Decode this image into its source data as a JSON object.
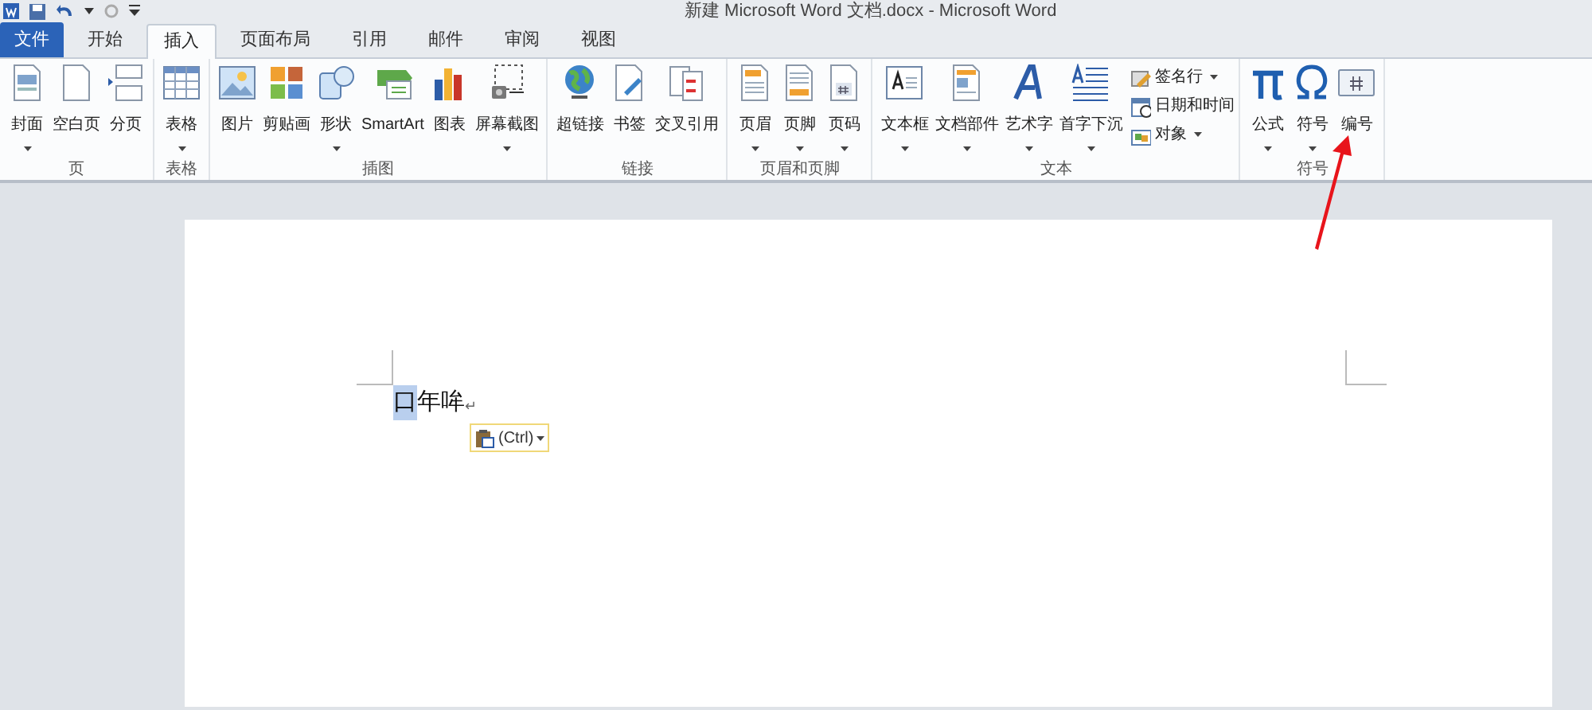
{
  "window": {
    "title": "新建 Microsoft Word 文档.docx - Microsoft Word"
  },
  "tabs": [
    {
      "label": "文件",
      "kind": "file",
      "selected": false
    },
    {
      "label": "开始",
      "kind": "tab",
      "selected": false
    },
    {
      "label": "插入",
      "kind": "tab",
      "selected": true
    },
    {
      "label": "页面布局",
      "kind": "tab",
      "selected": false
    },
    {
      "label": "引用",
      "kind": "tab",
      "selected": false
    },
    {
      "label": "邮件",
      "kind": "tab",
      "selected": false
    },
    {
      "label": "审阅",
      "kind": "tab",
      "selected": false
    },
    {
      "label": "视图",
      "kind": "tab",
      "selected": false
    }
  ],
  "ribbon_groups": [
    {
      "label": "页",
      "buttons": [
        {
          "label": "封面",
          "kind": "large",
          "dropdown": true
        },
        {
          "label": "空白页",
          "kind": "large",
          "dropdown": false
        },
        {
          "label": "分页",
          "kind": "large",
          "dropdown": false
        }
      ]
    },
    {
      "label": "表格",
      "buttons": [
        {
          "label": "表格",
          "kind": "large",
          "dropdown": true
        }
      ]
    },
    {
      "label": "插图",
      "buttons": [
        {
          "label": "图片",
          "kind": "large",
          "dropdown": false
        },
        {
          "label": "剪贴画",
          "kind": "large",
          "dropdown": false
        },
        {
          "label": "形状",
          "kind": "large",
          "dropdown": true
        },
        {
          "label": "SmartArt",
          "kind": "large",
          "dropdown": false
        },
        {
          "label": "图表",
          "kind": "large",
          "dropdown": false
        },
        {
          "label": "屏幕截图",
          "kind": "large",
          "dropdown": true
        }
      ]
    },
    {
      "label": "链接",
      "buttons": [
        {
          "label": "超链接",
          "kind": "large",
          "dropdown": false
        },
        {
          "label": "书签",
          "kind": "large",
          "dropdown": false
        },
        {
          "label": "交叉引用",
          "kind": "large",
          "dropdown": false
        }
      ]
    },
    {
      "label": "页眉和页脚",
      "buttons": [
        {
          "label": "页眉",
          "kind": "large",
          "dropdown": true
        },
        {
          "label": "页脚",
          "kind": "large",
          "dropdown": true
        },
        {
          "label": "页码",
          "kind": "large",
          "dropdown": true
        }
      ]
    },
    {
      "label": "文本",
      "buttons": [
        {
          "label": "文本框",
          "kind": "large",
          "dropdown": true
        },
        {
          "label": "文档部件",
          "kind": "large",
          "dropdown": true
        },
        {
          "label": "艺术字",
          "kind": "large",
          "dropdown": true
        },
        {
          "label": "首字下沉",
          "kind": "large",
          "dropdown": true
        },
        {
          "label": "签名行",
          "kind": "small",
          "dropdown": true
        },
        {
          "label": "日期和时间",
          "kind": "small",
          "dropdown": false
        },
        {
          "label": "对象",
          "kind": "small",
          "dropdown": true
        }
      ]
    },
    {
      "label": "符号",
      "buttons": [
        {
          "label": "公式",
          "kind": "large",
          "dropdown": true
        },
        {
          "label": "符号",
          "kind": "large",
          "dropdown": true
        },
        {
          "label": "编号",
          "kind": "large",
          "dropdown": false
        }
      ]
    }
  ],
  "document": {
    "runs": [
      {
        "text": "口",
        "selected": true
      },
      {
        "text": "年哞",
        "selected": false
      }
    ],
    "paragraph_mark": "↵",
    "paste_options": {
      "label": "(Ctrl)",
      "dropdown": true
    }
  }
}
